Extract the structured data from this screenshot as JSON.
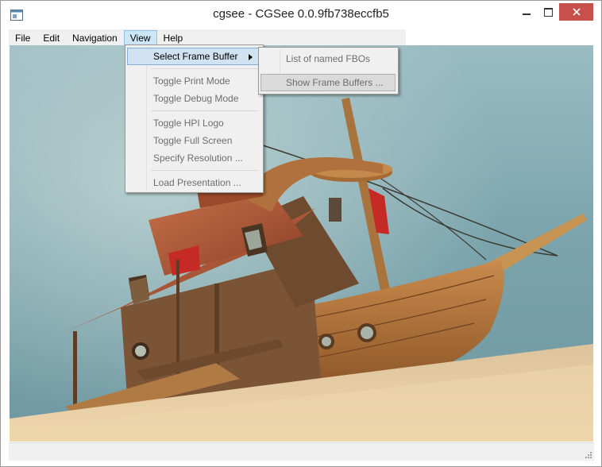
{
  "window": {
    "title": "cgsee - CGSee 0.0.9fb738eccfb5",
    "app_icon": "window-app-icon",
    "controls": [
      "minimize-icon",
      "maximize-icon",
      "close-icon"
    ]
  },
  "menubar": {
    "items": [
      {
        "label": "File",
        "active": false
      },
      {
        "label": "Edit",
        "active": false
      },
      {
        "label": "Navigation",
        "active": false
      },
      {
        "label": "View",
        "active": true
      },
      {
        "label": "Help",
        "active": false
      }
    ]
  },
  "view_menu": {
    "items": [
      {
        "label": "Select Frame Buffer",
        "enabled": true,
        "highlighted": true,
        "has_submenu": true
      },
      {
        "label": "Toggle Print Mode",
        "enabled": false
      },
      {
        "label": "Toggle Debug Mode",
        "enabled": false
      },
      {
        "label": "Toggle HPI Logo",
        "enabled": false
      },
      {
        "label": "Toggle Full Screen",
        "enabled": false
      },
      {
        "label": "Specify Resolution ...",
        "enabled": false
      },
      {
        "label": "Load Presentation ...",
        "enabled": false
      }
    ]
  },
  "frame_buffer_submenu": {
    "items": [
      {
        "label": "List of named FBOs",
        "enabled": false
      },
      {
        "label": "Show Frame Buffers ...",
        "enabled": false,
        "highlighted": true
      }
    ]
  },
  "colors": {
    "menu_active_bg": "#cde6f7",
    "menu_highlight_bg": "#d1e2f2",
    "close_button": "#c7504b",
    "sky_top": "#8fb3bd",
    "sand": "#e9cfa4"
  }
}
